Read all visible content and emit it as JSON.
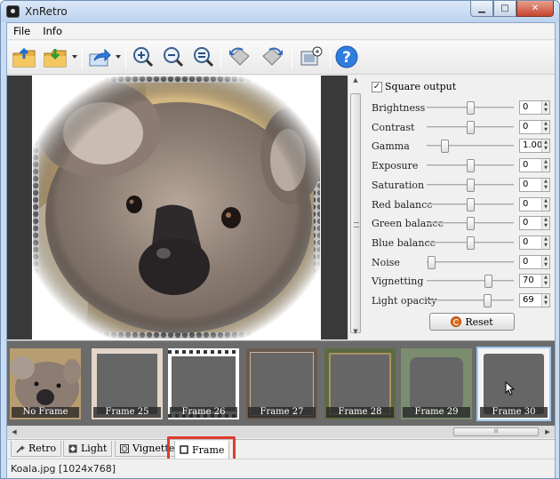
{
  "window": {
    "title": "XnRetro",
    "min": "▁",
    "max": "□",
    "close": "✕"
  },
  "menu": [
    "File",
    "Info"
  ],
  "settings": {
    "square_output_label": "Square output",
    "square_output_checked": true,
    "sliders": [
      {
        "label": "Brightness",
        "value": "0",
        "level": 0.5
      },
      {
        "label": "Contrast",
        "value": "0",
        "level": 0.5
      },
      {
        "label": "Gamma",
        "value": "1.00",
        "level": 0.2
      },
      {
        "label": "Exposure",
        "value": "0",
        "level": 0.5
      },
      {
        "label": "Saturation",
        "value": "0",
        "level": 0.5
      },
      {
        "label": "Red balance",
        "value": "0",
        "level": 0.5
      },
      {
        "label": "Green balance",
        "value": "0",
        "level": 0.5
      },
      {
        "label": "Blue balance",
        "value": "0",
        "level": 0.5
      },
      {
        "label": "Noise",
        "value": "0",
        "level": 0.05
      },
      {
        "label": "Vignetting",
        "value": "70",
        "level": 0.7
      },
      {
        "label": "Light opacity",
        "value": "69",
        "level": 0.69
      }
    ],
    "reset_label": "Reset"
  },
  "frames": [
    {
      "label": "No Frame"
    },
    {
      "label": "Frame 25"
    },
    {
      "label": "Frame 26"
    },
    {
      "label": "Frame 27"
    },
    {
      "label": "Frame 28"
    },
    {
      "label": "Frame 29"
    },
    {
      "label": "Frame 30"
    }
  ],
  "tabs": [
    {
      "label": "Retro"
    },
    {
      "label": "Light"
    },
    {
      "label": "Vignette"
    },
    {
      "label": "Frame"
    }
  ],
  "active_tab": "Frame",
  "status": "Koala.jpg [1024x768]",
  "hscroll_grip": "III"
}
